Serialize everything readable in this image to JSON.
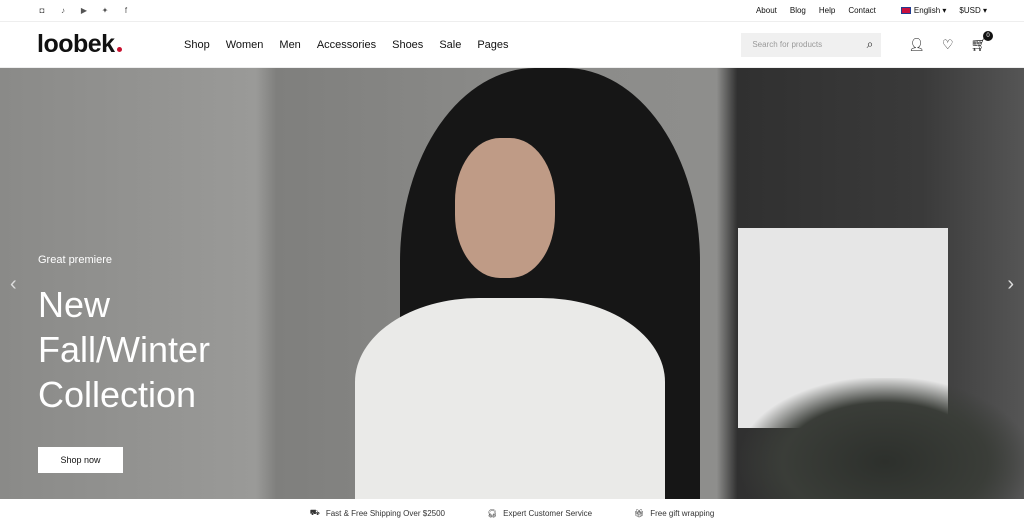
{
  "topbar": {
    "social": [
      {
        "icon": "instagram-icon",
        "glyph": "◘"
      },
      {
        "icon": "tiktok-icon",
        "glyph": "♪"
      },
      {
        "icon": "youtube-icon",
        "glyph": "▶"
      },
      {
        "icon": "twitter-icon",
        "glyph": "✦"
      },
      {
        "icon": "facebook-icon",
        "glyph": "f"
      }
    ],
    "links": [
      "About",
      "Blog",
      "Help",
      "Contact"
    ],
    "language": "English",
    "currency": "$USD"
  },
  "header": {
    "logo": "loobek",
    "nav": [
      "Shop",
      "Women",
      "Men",
      "Accessories",
      "Shoes",
      "Sale",
      "Pages"
    ],
    "search_placeholder": "Search for products",
    "cart_count": "0"
  },
  "hero": {
    "pretitle": "Great premiere",
    "title_lines": [
      "New",
      "Fall/Winter",
      "Collection"
    ],
    "cta": "Shop now"
  },
  "features": [
    "Fast & Free Shipping Over $2500",
    "Expert Customer Service",
    "Free gift wrapping"
  ]
}
